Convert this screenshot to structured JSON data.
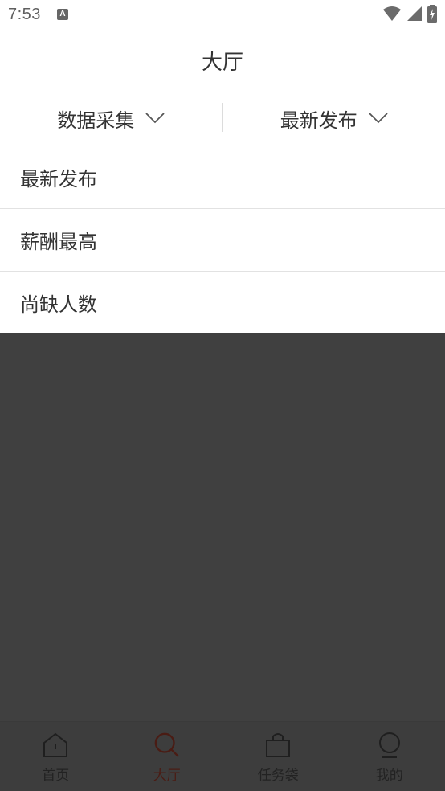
{
  "status_bar": {
    "time": "7:53",
    "notification_glyph": "A"
  },
  "header": {
    "title": "大厅"
  },
  "filters": [
    {
      "label": "数据采集",
      "icon": "chevron-down-icon"
    },
    {
      "label": "最新发布",
      "icon": "chevron-down-icon"
    }
  ],
  "dropdown": {
    "options": [
      {
        "label": "最新发布"
      },
      {
        "label": "薪酬最高"
      },
      {
        "label": "尚缺人数"
      }
    ]
  },
  "bottom_nav": {
    "items": [
      {
        "label": "首页",
        "icon": "home-icon",
        "active": false
      },
      {
        "label": "大厅",
        "icon": "search-icon",
        "active": true
      },
      {
        "label": "任务袋",
        "icon": "bag-icon",
        "active": false
      },
      {
        "label": "我的",
        "icon": "profile-icon",
        "active": false
      }
    ]
  },
  "colors": {
    "overlay": "#404040",
    "active_nav": "#4a1c14",
    "divider": "#e2e2e2"
  }
}
